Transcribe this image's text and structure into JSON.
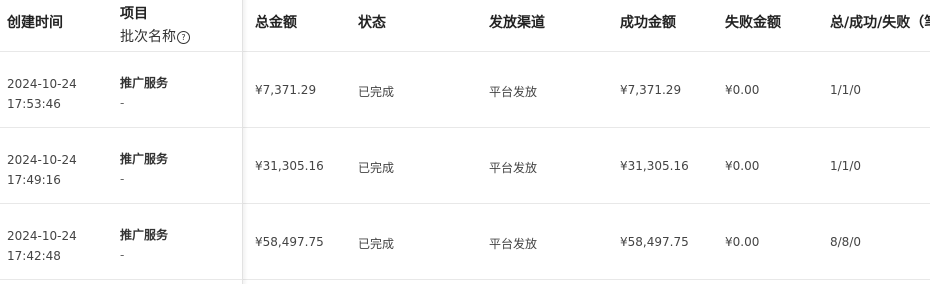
{
  "headers": {
    "created_time": "创建时间",
    "project": "项目",
    "batch_name": "批次名称",
    "total_amount": "总金额",
    "status": "状态",
    "channel": "发放渠道",
    "success_amount": "成功金额",
    "fail_amount": "失败金额",
    "counts": "总/成功/失败（笔"
  },
  "rows": [
    {
      "date": "2024-10-24",
      "time": "17:53:46",
      "project": "推广服务",
      "batch": "-",
      "total": "¥7,371.29",
      "status": "已完成",
      "channel": "平台发放",
      "success": "¥7,371.29",
      "fail": "¥0.00",
      "counts": "1/1/0"
    },
    {
      "date": "2024-10-24",
      "time": "17:49:16",
      "project": "推广服务",
      "batch": "-",
      "total": "¥31,305.16",
      "status": "已完成",
      "channel": "平台发放",
      "success": "¥31,305.16",
      "fail": "¥0.00",
      "counts": "1/1/0"
    },
    {
      "date": "2024-10-24",
      "time": "17:42:48",
      "project": "推广服务",
      "batch": "-",
      "total": "¥58,497.75",
      "status": "已完成",
      "channel": "平台发放",
      "success": "¥58,497.75",
      "fail": "¥0.00",
      "counts": "8/8/0"
    }
  ]
}
